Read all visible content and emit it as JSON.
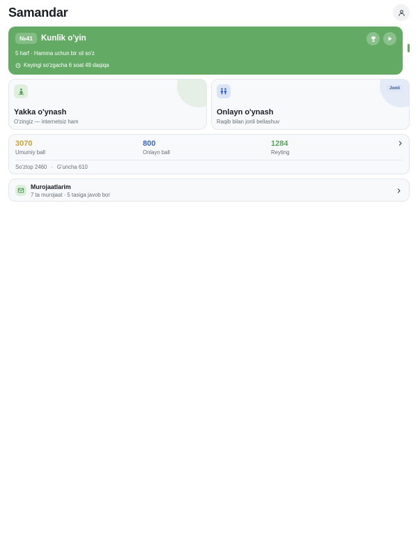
{
  "header": {
    "title": "Samandar",
    "profile_icon": "user-icon"
  },
  "daily": {
    "number": "№41",
    "title": "Kunlik o'yin",
    "subtitle": "5 harf · Hamma uchun bir xil so'z",
    "timer": "Keyingi so'zgacha 6 soat 49 daqiqa",
    "color": "#63ab65",
    "icons": [
      "trophy-icon",
      "play-icon",
      "clock-icon"
    ]
  },
  "modes": {
    "solo": {
      "title": "Yakka o'ynash",
      "subtitle": "O'zingiz — internetsiz ham",
      "icon": "solo-player-icon"
    },
    "online": {
      "title": "Onlayn o'ynash",
      "subtitle": "Raqib bilan jonli bellashuv",
      "badge": "Jonli",
      "icon": "duel-icon"
    }
  },
  "stats": {
    "total": {
      "value": "3070",
      "label": "Umumiy ball",
      "color": "#cfa033"
    },
    "online": {
      "value": "800",
      "label": "Onlayn ball",
      "color": "#3867c2"
    },
    "rating": {
      "value": "1284",
      "label": "Reyting",
      "color": "#5aa35f"
    },
    "wordtop": "So'ztop 2460",
    "separator": "·",
    "guncha": "G'uncha 610"
  },
  "appeals": {
    "title": "Murojaatlarim",
    "subtitle": "7 ta murojaat · 5 tasiga javob bor",
    "icon": "mail-icon"
  }
}
